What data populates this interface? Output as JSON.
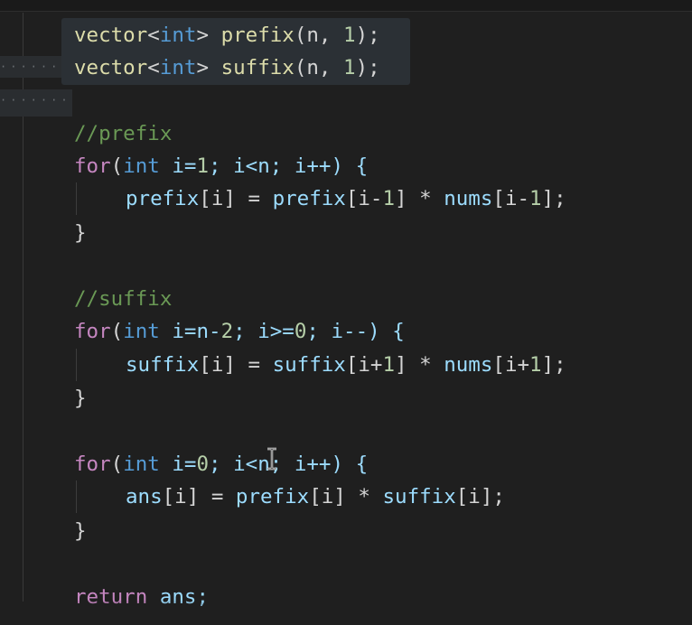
{
  "code": {
    "l1": {
      "type": "vector",
      "lt": "<",
      "int": "int",
      "gt": ">",
      "name": "prefix",
      "args_open": "(n, ",
      "one": "1",
      "args_close": ");"
    },
    "l2": {
      "type": "vector",
      "lt": "<",
      "int": "int",
      "gt": ">",
      "name": "suffix",
      "args_open": "(n, ",
      "one": "1",
      "args_close": ");"
    },
    "c1": "//prefix",
    "f1": {
      "for": "for",
      "open": "(",
      "int": "int",
      "rest1": " i=",
      "one": "1",
      "rest2": "; i<n; i++) {"
    },
    "b1": {
      "a": "prefix",
      "b": "[i] = ",
      "c": "prefix",
      "d": "[i-",
      "one1": "1",
      "e": "] * ",
      "f": "nums",
      "g": "[i-",
      "one2": "1",
      "h": "];"
    },
    "close1": "}",
    "c2": "//suffix",
    "f2": {
      "for": "for",
      "open": "(",
      "int": "int",
      "rest1": " i=n-",
      "two": "2",
      "rest2": "; i>=",
      "zero": "0",
      "rest3": "; i--) {"
    },
    "b2": {
      "a": "suffix",
      "b": "[i] = ",
      "c": "suffix",
      "d": "[i+",
      "one1": "1",
      "e": "] * ",
      "f": "nums",
      "g": "[i+",
      "one2": "1",
      "h": "];"
    },
    "close2": "}",
    "f3": {
      "for": "for",
      "open": "(",
      "int": "int",
      "rest1": " i=",
      "zero": "0",
      "rest2": "; i<n; i++) {"
    },
    "b3": {
      "a": "ans",
      "b": "[i] = ",
      "c": "prefix",
      "d": "[i] * ",
      "e": "suffix",
      "f": "[i];"
    },
    "close3": "}",
    "ret": {
      "kw": "return",
      "rest": " ans;"
    }
  },
  "gutter_dots": "·······",
  "cursor_icon": "text-cursor-icon",
  "colors": {
    "background": "#1f1f1f",
    "keyword_control": "#c586c0",
    "keyword_type": "#569cd6",
    "function": "#dcdcaa",
    "variable": "#9cdcfe",
    "number": "#b5cea8",
    "comment": "#6a9955",
    "selection": "#2b3035"
  }
}
